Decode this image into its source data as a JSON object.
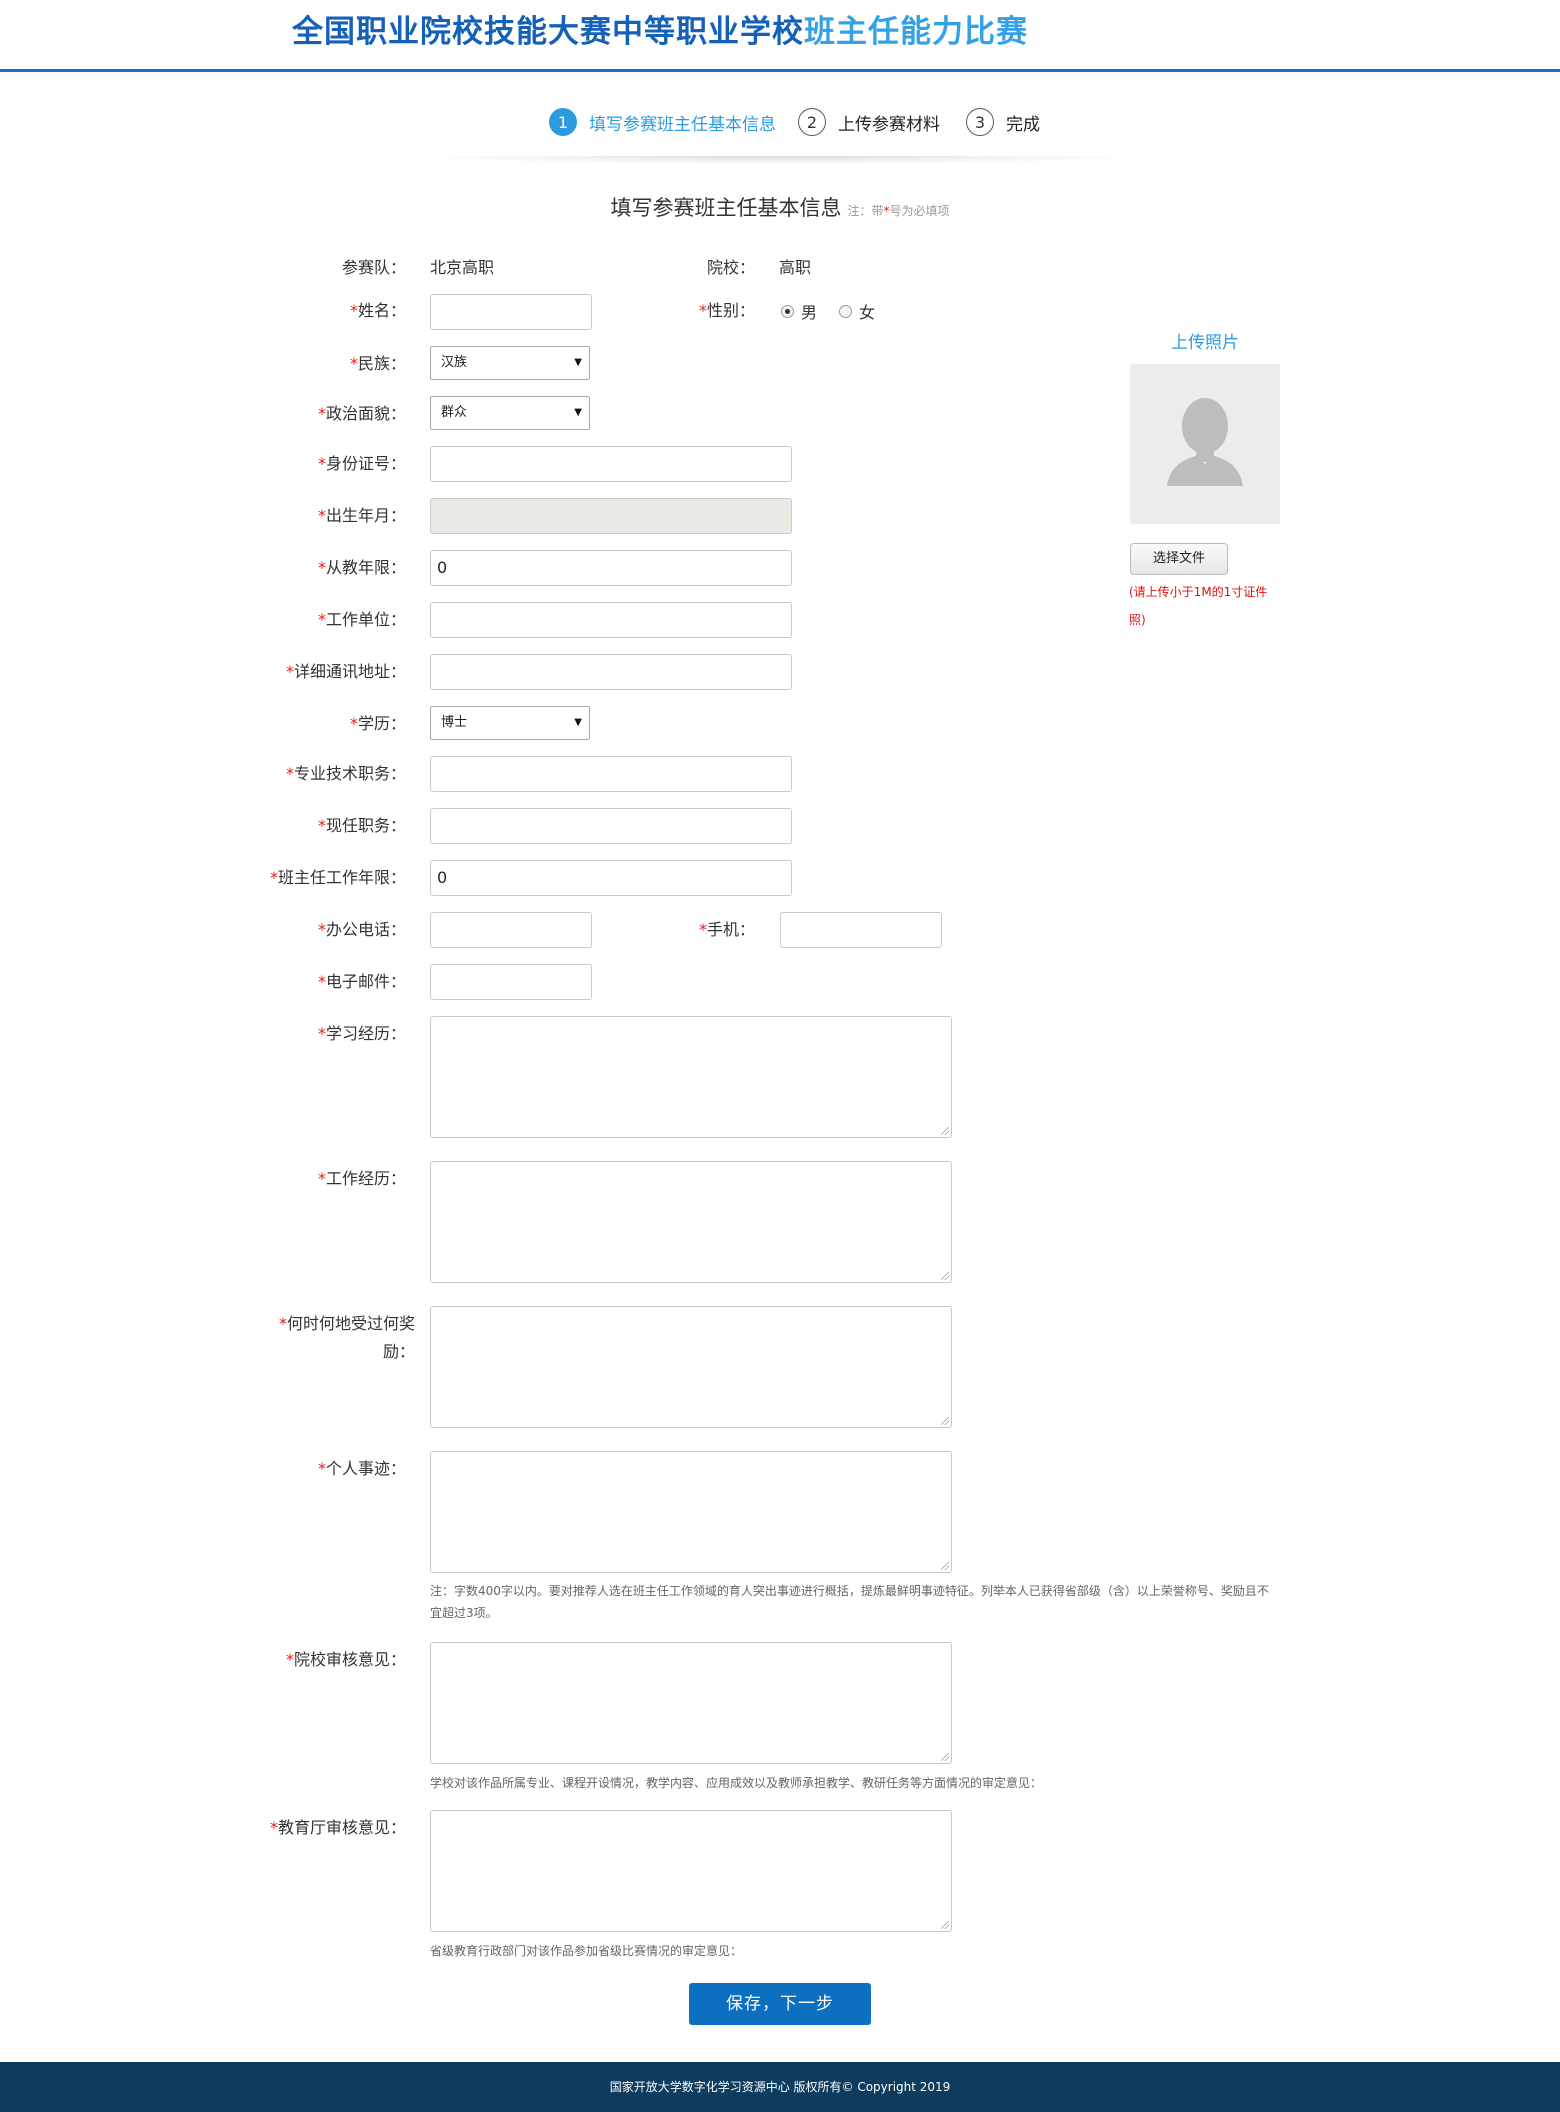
{
  "header": {
    "title_main": "全国职业院校技能大赛中等职业学校",
    "title_highlight": "班主任能力比赛"
  },
  "steps": [
    {
      "num": "1",
      "label": "填写参赛班主任基本信息",
      "active": true
    },
    {
      "num": "2",
      "label": "上传参赛材料",
      "active": false
    },
    {
      "num": "3",
      "label": "完成",
      "active": false
    }
  ],
  "form": {
    "title": "填写参赛班主任基本信息",
    "note_prefix": "注：带",
    "note_star": "*",
    "note_suffix": "号为必填项",
    "required_mark": "*",
    "team_label": "参赛队：",
    "team_value": "北京高职",
    "school_label": "院校：",
    "school_value": "高职",
    "name_label": "姓名：",
    "name_value": "",
    "gender_label": "性别：",
    "gender_options": [
      "男",
      "女"
    ],
    "gender_selected": "男",
    "ethnicity_label": "民族：",
    "ethnicity_value": "汉族",
    "political_label": "政治面貌：",
    "political_value": "群众",
    "id_label": "身份证号：",
    "id_value": "",
    "birth_label": "出生年月：",
    "birth_value": "",
    "teaching_years_label": "从教年限：",
    "teaching_years_value": "0",
    "workplace_label": "工作单位：",
    "workplace_value": "",
    "address_label": "详细通讯地址：",
    "address_value": "",
    "education_label": "学历：",
    "education_value": "博士",
    "title_label": "专业技术职务：",
    "title_value": "",
    "position_label": "现任职务：",
    "position_value": "",
    "hr_years_label": "班主任工作年限：",
    "hr_years_value": "0",
    "office_phone_label": "办公电话：",
    "office_phone_value": "",
    "mobile_label": "手机：",
    "mobile_value": "",
    "email_label": "电子邮件：",
    "email_value": "",
    "study_label": "学习经历：",
    "work_label": "工作经历：",
    "awards_label_line1": "何时何地受过何奖",
    "awards_label_line2": "励：",
    "deeds_label": "个人事迹：",
    "deeds_hint": "注：字数400字以内。要对推荐人选在班主任工作领域的育人突出事迹进行概括，提炼最鲜明事迹特征。列举本人已获得省部级（含）以上荣誉称号、奖励且不宜超过3项。",
    "school_review_label": "院校审核意见：",
    "school_review_hint": "学校对该作品所属专业、课程开设情况，教学内容、应用成效以及教师承担教学、教研任务等方面情况的审定意见：",
    "edu_review_label": "教育厅审核意见：",
    "edu_review_hint": "省级教育行政部门对该作品参加省级比赛情况的审定意见：",
    "submit_label": "保存，下一步"
  },
  "photo": {
    "title": "上传照片",
    "button_label": "选择文件",
    "note": "(请上传小于1M的1寸证件照)"
  },
  "footer": {
    "text": "国家开放大学数字化学习资源中心 版权所有© Copyright 2019"
  }
}
